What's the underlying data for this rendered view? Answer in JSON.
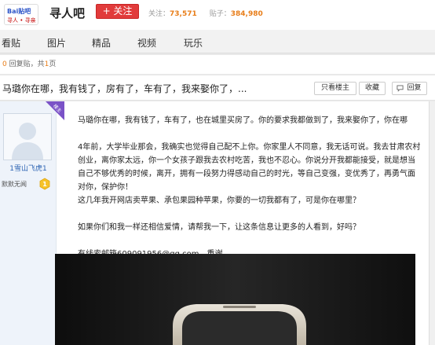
{
  "header": {
    "logo_text": "Bai贴吧",
    "logo_sub": "寻人 • 寻亲",
    "bar_name": "寻人吧",
    "follow_label": "+ 关注",
    "follow_stat_label": "关注：",
    "follow_count": "73,571",
    "post_stat_label": "贴子：",
    "post_count": "384,980"
  },
  "nav": {
    "tabs": [
      "看贴",
      "图片",
      "精品",
      "视频",
      "玩乐"
    ]
  },
  "breadcrumb": {
    "reply_count": "0",
    "reply_text": " 回复贴，共",
    "page_count": "1",
    "page_text": "页"
  },
  "thread": {
    "title": "马璐你在哪，我有钱了，房有了，车有了，我来娶你了，...",
    "only_owner_label": "只看楼主",
    "favorite_label": "收藏",
    "reply_label": "回复"
  },
  "author": {
    "louzhu_label": "楼主",
    "name": "1雪山飞虎1",
    "level_text": "默默无闻",
    "badge_level": "1"
  },
  "post": {
    "paragraphs": [
      "马璐你在哪，我有钱了，车有了，也在城里买房了。你的要求我都做到了，我来娶你了，你在哪",
      "4年前，大学毕业那会，我确实也觉得自己配不上你。你家里人不同意，我无话可说。我去甘肃农村创业，离你家太远，你一个女孩子跟我去农村吃苦，我也不忍心。你说分开我都能接受，就是想当自己不够优秀的时候，离开，拥有一段努力得感动自己的时光，等自己变强，变优秀了，再勇气面对你，保护你！\n这几年我开网店卖苹果、承包果园种苹果，你要的一切我都有了，可是你在哪里？",
      "如果你们和我一样还相信爱情，请帮我一下，让这条信息让更多的人看到，好吗？",
      "有线索邮箱609091956@qq.com，重谢"
    ]
  },
  "colors": {
    "accent_red": "#e13b3b",
    "stat_orange": "#e87d18",
    "link_blue": "#2d64b3",
    "louzhu_purple": "#7a52c7"
  }
}
